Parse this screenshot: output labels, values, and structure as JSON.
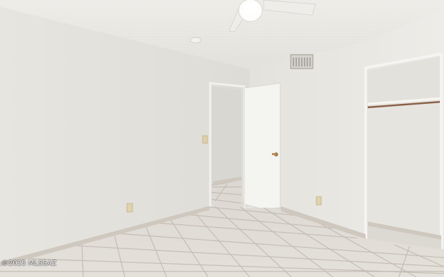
{
  "photo": {
    "watermark": "©2025 MLSSAZ"
  },
  "palette": {
    "ceiling": "#e8e6e1",
    "left_wall": "#e4e2dd",
    "back_wall": "#e1dfda",
    "right_wall": "#e9e7e2",
    "door": "#f4f4f1",
    "floor_tile": "#ddd9d3",
    "grout": "#c3bdb5",
    "baseboard": "#cfc8bf",
    "closet_rod": "#8a6048"
  }
}
